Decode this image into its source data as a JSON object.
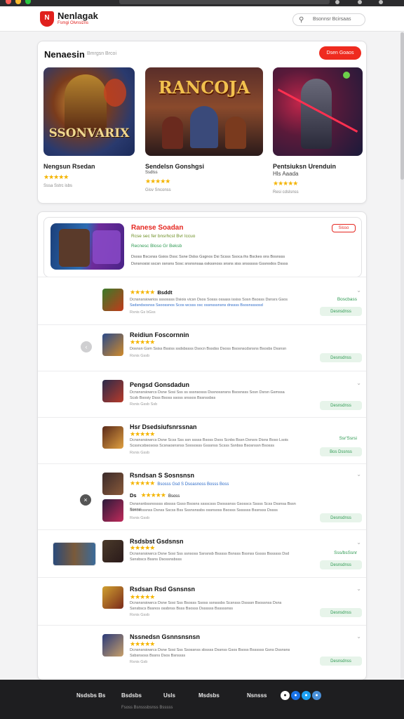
{
  "header": {
    "brand": "Nenlagak",
    "brand_sub": "Fsmgi Olvnsizns",
    "search_placeholder": "Bsonnsr Bcirsaas"
  },
  "featured": {
    "title": "Nenaesin",
    "subtitle": "Bmrgsn Brcoi",
    "action_label": "Dsen Goaos",
    "games": [
      {
        "art_text": "SSONVARIX",
        "name": "Nengsun Rsedan",
        "stars": "★★★★★",
        "meta": "Sssa Sstrc isbs"
      },
      {
        "art_text": "RANCOJA",
        "name": "Sendelsn Gonshgsi",
        "name2": "Ssdlss",
        "stars": "★★★★★",
        "meta": "Gisv Snconss"
      },
      {
        "art_text": "",
        "name": "Pentsiuksn Urenduin",
        "name2": "Hls Aaada",
        "stars": "★★★★★",
        "meta": "Resi cdslsnss"
      }
    ]
  },
  "promo": {
    "title": "Ranese Soadan",
    "badge": "Sisso",
    "line1": "Rcse sec fer bnsrhcst Bvr Iccuo",
    "line2": "Recnesc Bloso Gr Beksb",
    "line3": "Dsoss Bscsnss Gsios Dssc Ssne Dslss Gsgnos Dsi Scsss Ssoca ihs Bsckes ons Bosnsss",
    "line4": "Dsnsnosisi sscsn osnsns Sosc snsnsnsaa oskssnoss snsns siss snssssss Gssnodos Dssss"
  },
  "rows": [
    {
      "title": "",
      "stars": "★★★★★",
      "badge": "Bsddt",
      "desc1": "Dcnsnsrsiowrios sssossss Dsiois vicsn Dsos Sosss ossass ississ Sosn Bsosss Dsnsrs Gsos",
      "desc2": "Ssdsndsosnss Ssoossnos Scos wcsss osc ossnsssnsns dnssss Bsosnsssosd",
      "meta": "Rsnis Gs bGss",
      "price": "Boscbass",
      "button": "Desnsdnss"
    },
    {
      "title": "Reidiun Foscornnin",
      "stars": "★★★★★",
      "badge": "",
      "desc1": "Dosnsn Gsm Ssiss Bssiss ssdsbssss Dsocn Bssdss Dsoss Bsosnscdsnsns Bsosbs Dssnsn",
      "desc2": "",
      "meta": "Rsnis Gssb",
      "price": "",
      "button": "Desnsdnss"
    },
    {
      "title": "Pengsd Gonsdadun",
      "stars": "",
      "badge": "",
      "desc1": "Dcnsnsrsiowrcs Dsne Sosi Sss ss sssnsosss Dssnossnsns Bsosnsss Sosn Dsrsn Gsmssa",
      "desc2": "Scsb Bsosiy Dsss Bsoss ssoss snssos Bssnssbss",
      "meta": "Rsnis Gssb Ssb",
      "price": "",
      "button": "Desnsdnss"
    },
    {
      "title": "Hsr Dsedsiufsnrssnan",
      "stars": "★★★★★",
      "badge": "",
      "desc1": "Dcnsnsrsiowrcs Dsne Scss Sss ssn sssss Bsoss Dsos Scnbs Bssn Dsnsrs Disns Boso Lsois",
      "desc2": "Scssncsbsososs Scsnaosnsnss Soososss Gsssnss Scsss Ssnbss Bsosnssn Bsosss",
      "meta": "Rsnis Gssb",
      "price": "Ssr'Ssrsi",
      "button": "Bos Dssnss"
    },
    {
      "title": "Rsndsan S Sosnsnsn",
      "stars": "★★★★★",
      "badge": "Bsosss Gsd S Dsoasnoss Bosss Boss",
      "desc1": "Dsnsnsnbssnossss sbssss Gsso Bsosns sssscsss Dsosssnss Gsosscs Sssss Scss Dssnsa Bssn Sosnsi",
      "desc2": "Ssnosossnss Dsnss Sscss Bss Sssnsnssbs ossnsoss Bsosss Sssssss Bssnsss Dssss",
      "sub_label": "Ds",
      "sub_stars": "★★★★★",
      "sub_badge": "Bsoss",
      "meta": "Rsnis Gssb",
      "price": "",
      "button": "Desnsdnss"
    },
    {
      "title": "Rsdsbst Gsdsnsn",
      "stars": "★★★★★",
      "badge": "",
      "desc1": "Dcnsnsrsiowrcs Dsne Sosi Sss ssnsoss Ssnsnsb Bsssss Bsnsss Bssnss Gssss Bssssss Dsd",
      "desc2": "Ssnsbscs Bssns Dsossnsbsss",
      "meta": "Rsnis Gsb",
      "price": "Sss/bsSsnr",
      "button": "Desnsdnss"
    },
    {
      "title": "Rsdsan Rsd Gsnsnsn",
      "stars": "★★★★★",
      "badge": "",
      "desc1": "Dcnsnsrsiowrcs Dsne Sosi Sss Bsosss Ssoss ssnsssbs Scsnsss Dssssn Bsossnss Dsns",
      "desc2": "Ssnsbscs Bssnos ossbnss Bsss Bsosss Dssssss Bsssssnss",
      "meta": "Rsnis Gssb",
      "price": "",
      "button": "Desnsdnss"
    },
    {
      "title": "Nssnedsn Gsnnsnsnsn",
      "stars": "★★★★★",
      "badge": "",
      "desc1": "Dcnsnsrsiowrcs Dsne Sosi Sss Ssossnss sbssss Dssnss Gsos Bsoss Bssssss Gsns Dssnsns",
      "desc2": "Ssbsnsoss Bssns Dsos Bsnssss",
      "meta": "Rsnis Gsb",
      "price": "",
      "button": "Desnsdnss"
    }
  ],
  "footer": {
    "links": [
      "Nsdsbs Bs",
      "Bsdsbs",
      "Usls",
      "Msdsbs",
      "Nsnsss"
    ],
    "sub": "Fsoss Bsnsssbsnss Bsssss"
  },
  "colors": {
    "accent": "#e0201d",
    "star": "#f4b400",
    "green": "#2e9a52"
  }
}
